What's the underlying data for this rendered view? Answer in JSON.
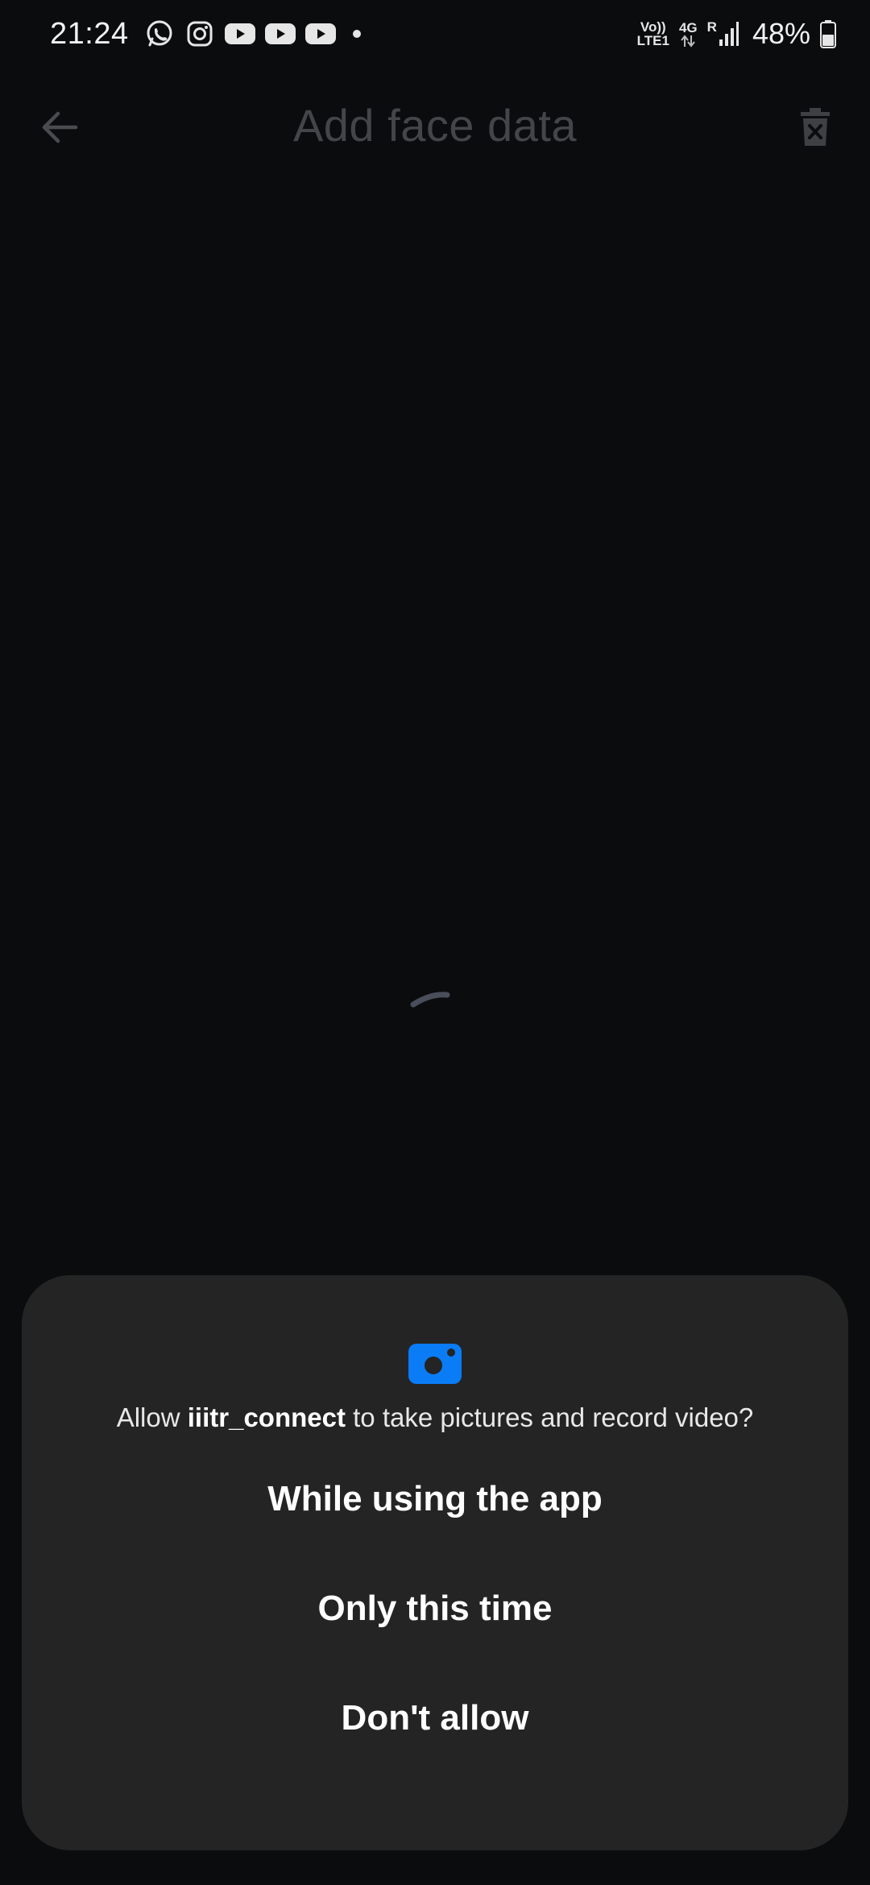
{
  "status_bar": {
    "time": "21:24",
    "notifications": [
      "whatsapp-icon",
      "instagram-icon",
      "youtube-icon",
      "youtube-icon",
      "youtube-icon"
    ],
    "volte_top": "Vo))",
    "volte_bottom": "LTE1",
    "network_type": "4G",
    "roaming": "R",
    "battery_percent": "48%"
  },
  "app_bar": {
    "title": "Add face data",
    "back_icon": "arrow-left-icon",
    "delete_icon": "trash-x-icon"
  },
  "loader": {
    "icon": "loading-spinner"
  },
  "dialog": {
    "icon": "camera-icon",
    "icon_color": "#0a7cf5",
    "message_prefix": "Allow ",
    "app_name": "iiitr_connect",
    "message_suffix": " to take pictures and record video?",
    "options": [
      "While using the app",
      "Only this time",
      "Don't allow"
    ]
  },
  "colors": {
    "background": "#0b0c0e",
    "dialog_bg": "#242424",
    "title_dim": "#444549",
    "accent": "#0a7cf5"
  }
}
